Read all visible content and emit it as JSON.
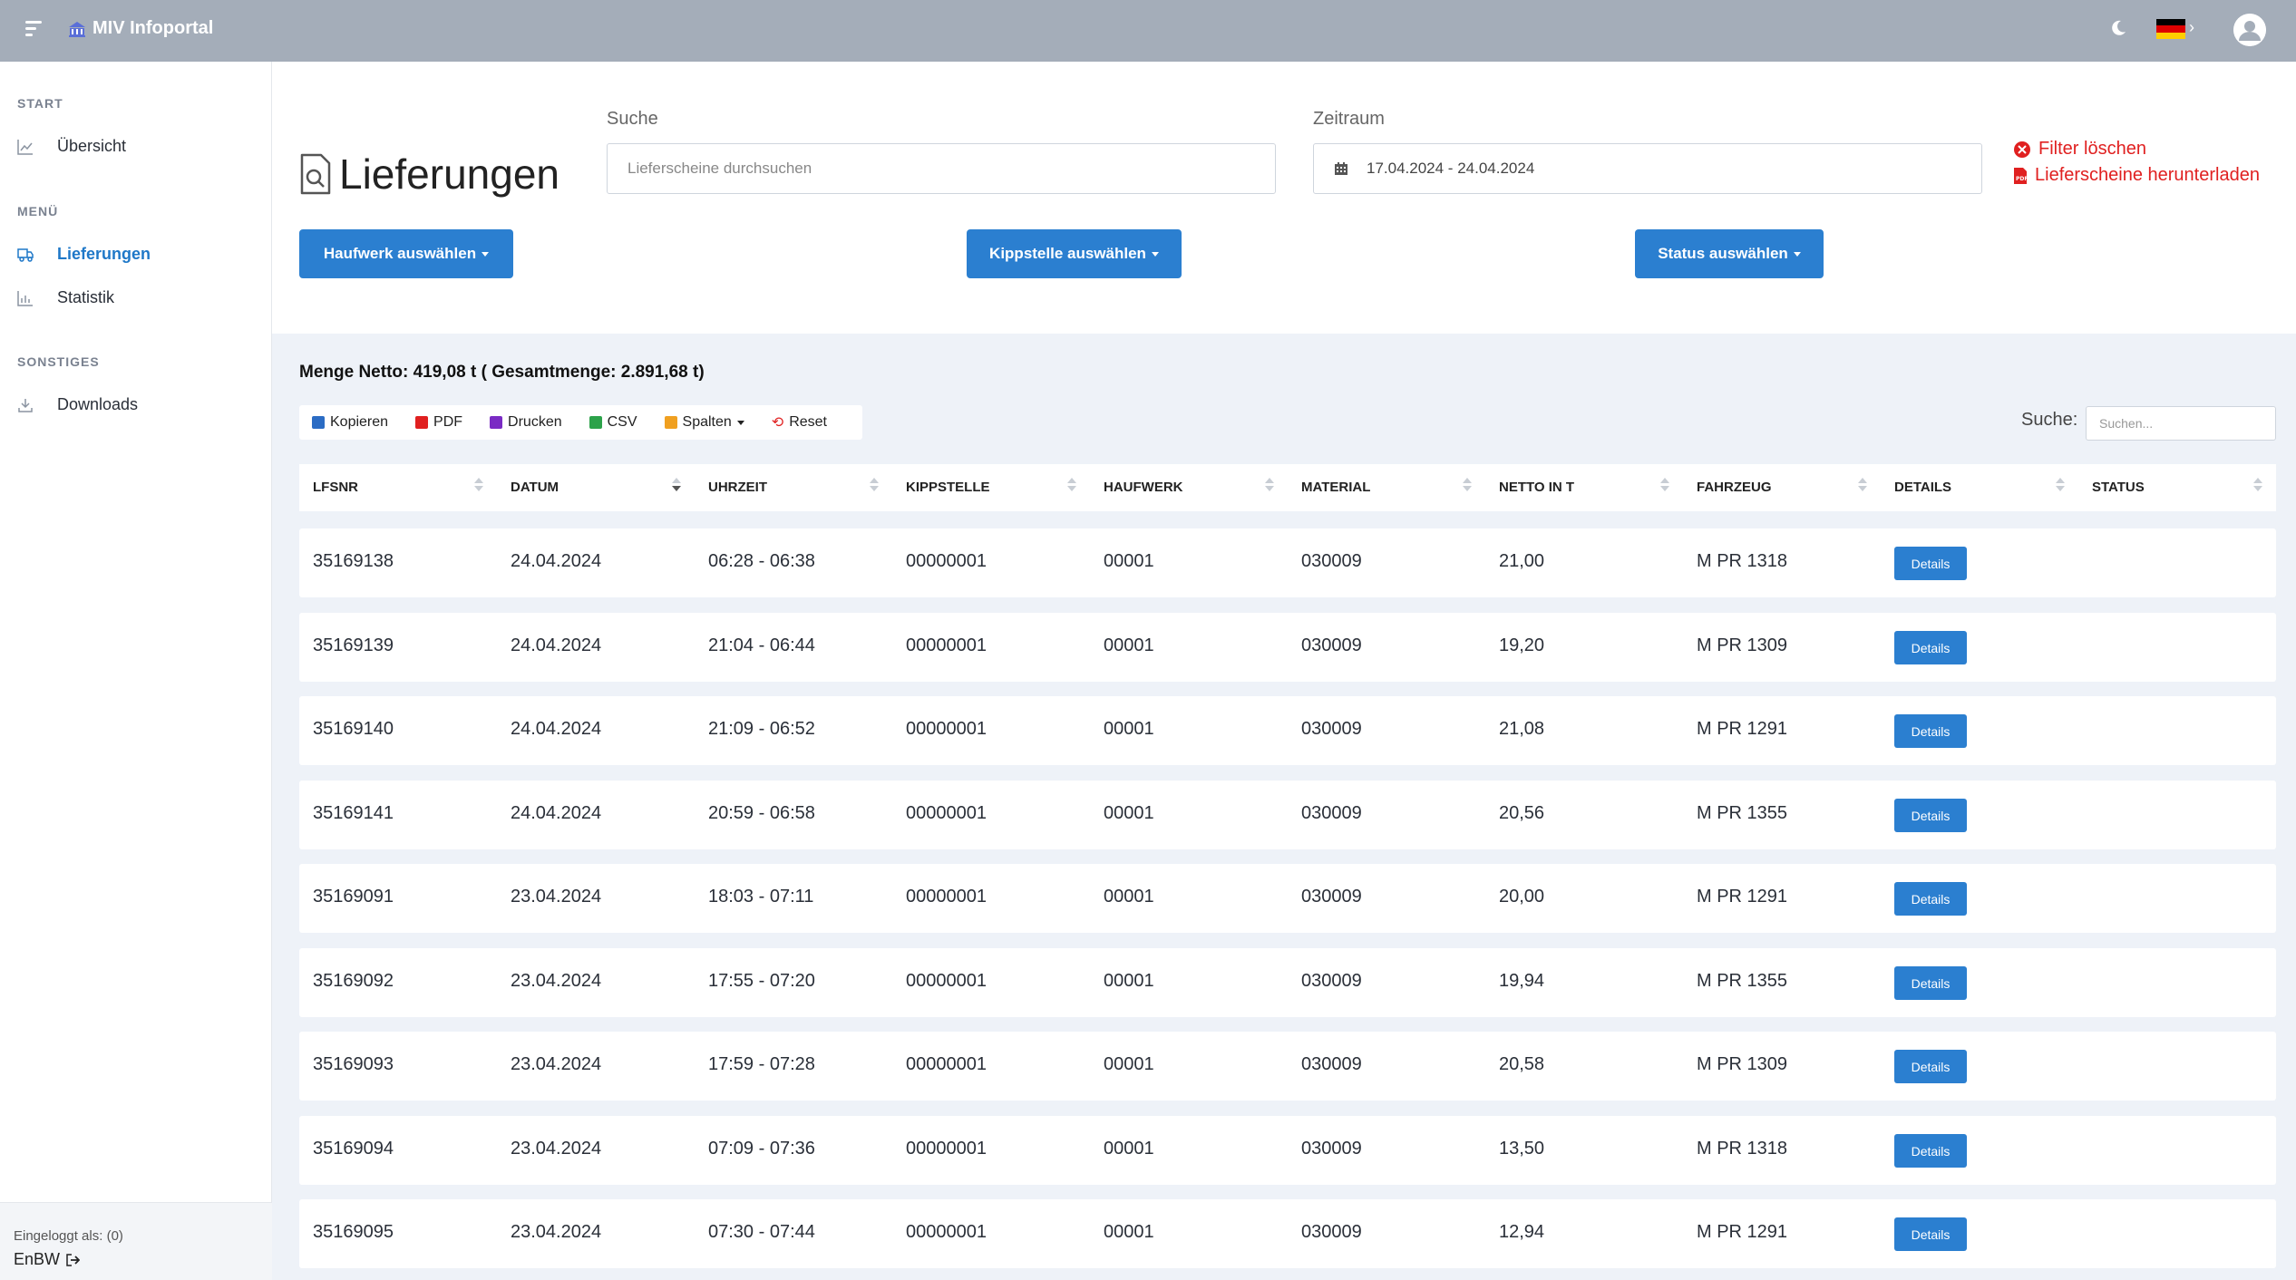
{
  "app": {
    "title": "MIV Infoportal"
  },
  "sidebar": {
    "sections": [
      {
        "title": "START",
        "items": [
          {
            "label": "Übersicht"
          }
        ]
      },
      {
        "title": "MENÜ",
        "items": [
          {
            "label": "Lieferungen"
          },
          {
            "label": "Statistik"
          }
        ]
      },
      {
        "title": "SONSTIGES",
        "items": [
          {
            "label": "Downloads"
          }
        ]
      }
    ],
    "footer": {
      "logged_in": "Eingeloggt als: (0)",
      "user": "EnBW"
    }
  },
  "page": {
    "title": "Lieferungen",
    "search_label": "Suche",
    "search_placeholder": "Lieferscheine durchsuchen",
    "period_label": "Zeitraum",
    "period_value": "17.04.2024 - 24.04.2024",
    "clear_filter": "Filter löschen",
    "download": "Lieferscheine herunterladen",
    "btn_haufwerk": "Haufwerk auswählen",
    "btn_kippstelle": "Kippstelle auswählen",
    "btn_status": "Status auswählen"
  },
  "summary": "Menge Netto: 419,08 t ( Gesamtmenge: 2.891,68 t)",
  "toolbar": {
    "copy": "Kopieren",
    "pdf": "PDF",
    "print": "Drucken",
    "csv": "CSV",
    "columns": "Spalten",
    "reset": "Reset"
  },
  "table_search": {
    "label": "Suche:",
    "placeholder": "Suchen..."
  },
  "colors": {
    "accent": "#2b7fd0",
    "danger": "#e02020",
    "status_red": "#ee0000",
    "topbar": "#a4adb9"
  },
  "table": {
    "columns": [
      "LFSNR",
      "DATUM",
      "UHRZEIT",
      "KIPPSTELLE",
      "HAUFWERK",
      "MATERIAL",
      "NETTO IN T",
      "FAHRZEUG",
      "DETAILS",
      "STATUS"
    ],
    "details_label": "Details",
    "rows": [
      [
        "35169138",
        "24.04.2024",
        "06:28 - 06:38",
        "00000001",
        "00001",
        "030009",
        "21,00",
        "M PR 1318"
      ],
      [
        "35169139",
        "24.04.2024",
        "21:04 - 06:44",
        "00000001",
        "00001",
        "030009",
        "19,20",
        "M PR 1309"
      ],
      [
        "35169140",
        "24.04.2024",
        "21:09 - 06:52",
        "00000001",
        "00001",
        "030009",
        "21,08",
        "M PR 1291"
      ],
      [
        "35169141",
        "24.04.2024",
        "20:59 - 06:58",
        "00000001",
        "00001",
        "030009",
        "20,56",
        "M PR 1355"
      ],
      [
        "35169091",
        "23.04.2024",
        "18:03 - 07:11",
        "00000001",
        "00001",
        "030009",
        "20,00",
        "M PR 1291"
      ],
      [
        "35169092",
        "23.04.2024",
        "17:55 - 07:20",
        "00000001",
        "00001",
        "030009",
        "19,94",
        "M PR 1355"
      ],
      [
        "35169093",
        "23.04.2024",
        "17:59 - 07:28",
        "00000001",
        "00001",
        "030009",
        "20,58",
        "M PR 1309"
      ],
      [
        "35169094",
        "23.04.2024",
        "07:09 - 07:36",
        "00000001",
        "00001",
        "030009",
        "13,50",
        "M PR 1318"
      ],
      [
        "35169095",
        "23.04.2024",
        "07:30 - 07:44",
        "00000001",
        "00001",
        "030009",
        "12,94",
        "M PR 1291"
      ]
    ]
  }
}
